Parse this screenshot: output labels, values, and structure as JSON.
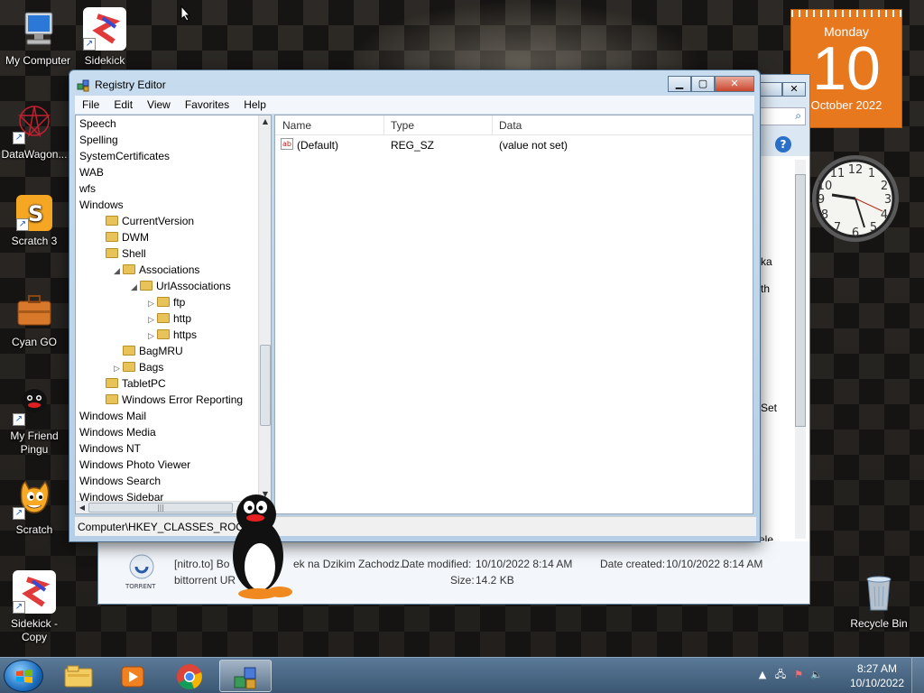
{
  "desktop": {
    "icons": [
      {
        "label": "My Computer",
        "icon": "computer-icon"
      },
      {
        "label": "Sidekick",
        "icon": "sidekick-icon"
      },
      {
        "label": "DataWagon...",
        "icon": "datawagon-icon"
      },
      {
        "label": "Scratch 3",
        "icon": "scratch3-icon"
      },
      {
        "label": "Cyan GO",
        "icon": "briefcase-icon"
      },
      {
        "label": "My Friend Pingu",
        "icon": "pingu-icon"
      },
      {
        "label": "Scratch",
        "icon": "scratch-cat-icon"
      },
      {
        "label": "Sidekick - Copy",
        "icon": "sidekick-icon"
      },
      {
        "label": "Recycle Bin",
        "icon": "recycle-bin-icon"
      }
    ]
  },
  "calendar": {
    "weekday": "Monday",
    "day": "10",
    "month_year": "October 2022"
  },
  "background_window": {
    "file_name": "[nitro.to] Bo",
    "file_name_rest": "ek na Dzikim Zachodz...",
    "file_type": "bittorrent UR",
    "torrent_label": "TORRENT",
    "date_modified_label": "Date modified:",
    "date_modified": "10/10/2022 8:14 AM",
    "date_created_label": "Date created:",
    "date_created": "10/10/2022 8:14 AM",
    "size_label": "Size:",
    "size": "14.2 KB",
    "partial_ka": "ka",
    "partial_th": "th",
    "partial_set": "Set",
    "partial_ele": "ele"
  },
  "regedit": {
    "title": "Registry Editor",
    "menu": [
      "File",
      "Edit",
      "View",
      "Favorites",
      "Help"
    ],
    "tree": [
      {
        "label": "Speech",
        "level": 0,
        "expander": "",
        "folder": false
      },
      {
        "label": "Spelling",
        "level": 0,
        "expander": "",
        "folder": false
      },
      {
        "label": "SystemCertificates",
        "level": 0,
        "expander": "",
        "folder": false
      },
      {
        "label": "WAB",
        "level": 0,
        "expander": "",
        "folder": false
      },
      {
        "label": "wfs",
        "level": 0,
        "expander": "",
        "folder": false
      },
      {
        "label": "Windows",
        "level": 0,
        "expander": "",
        "folder": false
      },
      {
        "label": "CurrentVersion",
        "level": 1,
        "expander": "",
        "folder": true
      },
      {
        "label": "DWM",
        "level": 1,
        "expander": "",
        "folder": true
      },
      {
        "label": "Shell",
        "level": 1,
        "expander": "",
        "folder": true
      },
      {
        "label": "Associations",
        "level": 2,
        "expander": "◢",
        "folder": true
      },
      {
        "label": "UrlAssociations",
        "level": 3,
        "expander": "◢",
        "folder": true
      },
      {
        "label": "ftp",
        "level": 4,
        "expander": "▷",
        "folder": true
      },
      {
        "label": "http",
        "level": 4,
        "expander": "▷",
        "folder": true
      },
      {
        "label": "https",
        "level": 4,
        "expander": "▷",
        "folder": true
      },
      {
        "label": "BagMRU",
        "level": 2,
        "expander": "",
        "folder": true
      },
      {
        "label": "Bags",
        "level": 2,
        "expander": "▷",
        "folder": true
      },
      {
        "label": "TabletPC",
        "level": 1,
        "expander": "",
        "folder": true
      },
      {
        "label": "Windows Error Reporting",
        "level": 1,
        "expander": "",
        "folder": true
      },
      {
        "label": "Windows Mail",
        "level": 0,
        "expander": "",
        "folder": false
      },
      {
        "label": "Windows Media",
        "level": 0,
        "expander": "",
        "folder": false
      },
      {
        "label": "Windows NT",
        "level": 0,
        "expander": "",
        "folder": false
      },
      {
        "label": "Windows Photo Viewer",
        "level": 0,
        "expander": "",
        "folder": false
      },
      {
        "label": "Windows Search",
        "level": 0,
        "expander": "",
        "folder": false
      },
      {
        "label": "Windows Sidebar",
        "level": 0,
        "expander": "",
        "folder": false
      }
    ],
    "columns": [
      "Name",
      "Type",
      "Data"
    ],
    "values": [
      {
        "name": "(Default)",
        "type": "REG_SZ",
        "data": "(value not set)"
      }
    ],
    "status_path": "Computer\\HKEY_CLASSES_ROOT"
  },
  "taskbar": {
    "time": "8:27 AM",
    "date": "10/10/2022",
    "pinned": [
      "explorer-icon",
      "media-player-icon",
      "chrome-icon",
      "regedit-icon"
    ]
  }
}
